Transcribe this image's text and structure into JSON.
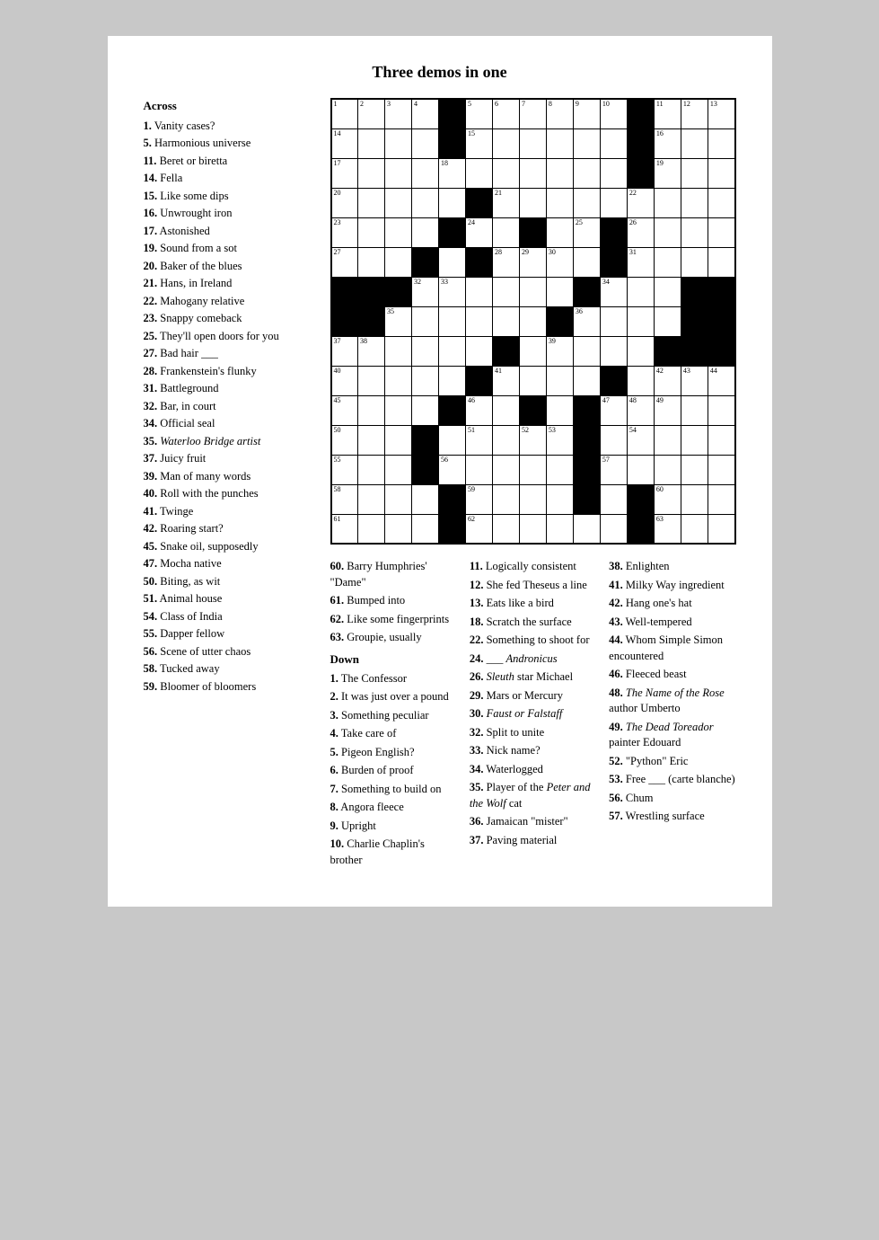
{
  "title": "Three demos in one",
  "across_label": "Across",
  "across_clues": [
    {
      "num": "1",
      "text": "Vanity cases?"
    },
    {
      "num": "5",
      "text": "Harmonious universe"
    },
    {
      "num": "11",
      "text": "Beret or biretta"
    },
    {
      "num": "14",
      "text": "Fella"
    },
    {
      "num": "15",
      "text": "Like some dips"
    },
    {
      "num": "16",
      "text": "Unwrought iron"
    },
    {
      "num": "17",
      "text": "Astonished"
    },
    {
      "num": "19",
      "text": "Sound from a sot"
    },
    {
      "num": "20",
      "text": "Baker of the blues"
    },
    {
      "num": "21",
      "text": "Hans, in Ireland"
    },
    {
      "num": "22",
      "text": "Mahogany relative"
    },
    {
      "num": "23",
      "text": "Snappy comeback"
    },
    {
      "num": "25",
      "text": "They'll open doors for you"
    },
    {
      "num": "27",
      "text": "Bad hair ___"
    },
    {
      "num": "28",
      "text": "Frankenstein's flunky"
    },
    {
      "num": "31",
      "text": "Battleground"
    },
    {
      "num": "32",
      "text": "Bar, in court"
    },
    {
      "num": "34",
      "text": "Official seal"
    },
    {
      "num": "35",
      "text": "Waterloo Bridge artist",
      "italic": true
    },
    {
      "num": "37",
      "text": "Juicy fruit"
    },
    {
      "num": "39",
      "text": "Man of many words"
    },
    {
      "num": "40",
      "text": "Roll with the punches"
    },
    {
      "num": "41",
      "text": "Twinge"
    },
    {
      "num": "42",
      "text": "Roaring start?"
    },
    {
      "num": "45",
      "text": "Snake oil, supposedly"
    },
    {
      "num": "47",
      "text": "Mocha native"
    },
    {
      "num": "50",
      "text": "Biting, as wit"
    },
    {
      "num": "51",
      "text": "Animal house"
    },
    {
      "num": "54",
      "text": "Class of India"
    },
    {
      "num": "55",
      "text": "Dapper fellow"
    },
    {
      "num": "56",
      "text": "Scene of utter chaos"
    },
    {
      "num": "58",
      "text": "Tucked away"
    },
    {
      "num": "59",
      "text": "Bloomer of bloomers"
    }
  ],
  "right_clues_col1": [
    {
      "num": "60",
      "text": "Barry Humphries' \"Dame\""
    },
    {
      "num": "61",
      "text": "Bumped into"
    },
    {
      "num": "62",
      "text": "Like some fingerprints"
    },
    {
      "num": "63",
      "text": "Groupie, usually"
    }
  ],
  "down_label": "Down",
  "down_clues_col1": [
    {
      "num": "1",
      "text": "The Confessor"
    },
    {
      "num": "2",
      "text": "It was just over a pound"
    },
    {
      "num": "3",
      "text": "Something peculiar"
    },
    {
      "num": "4",
      "text": "Take care of"
    },
    {
      "num": "5",
      "text": "Pigeon English?"
    },
    {
      "num": "6",
      "text": "Burden of proof"
    },
    {
      "num": "7",
      "text": "Something to build on"
    },
    {
      "num": "8",
      "text": "Angora fleece"
    },
    {
      "num": "9",
      "text": "Upright"
    },
    {
      "num": "10",
      "text": "Charlie Chaplin's brother"
    }
  ],
  "down_clues_col2": [
    {
      "num": "11",
      "text": "Logically consistent"
    },
    {
      "num": "12",
      "text": "She fed Theseus a line"
    },
    {
      "num": "13",
      "text": "Eats like a bird"
    },
    {
      "num": "18",
      "text": "Scratch the surface"
    },
    {
      "num": "22",
      "text": "Something to shoot for"
    },
    {
      "num": "24",
      "text": "___ Andronicus",
      "italic_part": "Andronicus"
    },
    {
      "num": "26",
      "text": "Sleuth star Michael",
      "italic_part": "Sleuth"
    },
    {
      "num": "29",
      "text": "Mars or Mercury"
    },
    {
      "num": "30",
      "text": "Faust or Falstaff",
      "italic_part": "Faust or Falstaff"
    },
    {
      "num": "32",
      "text": "Split to unite"
    },
    {
      "num": "33",
      "text": "Nick name?"
    },
    {
      "num": "34",
      "text": "Waterlogged"
    },
    {
      "num": "35",
      "text": "Player of the Peter and the Wolf cat",
      "italic_part": "Peter and the Wolf"
    },
    {
      "num": "36",
      "text": "Jamaican \"mister\""
    },
    {
      "num": "37",
      "text": "Paving material"
    }
  ],
  "down_clues_col3": [
    {
      "num": "38",
      "text": "Enlighten"
    },
    {
      "num": "41",
      "text": "Milky Way ingredient"
    },
    {
      "num": "42",
      "text": "Hang one's hat"
    },
    {
      "num": "43",
      "text": "Well-tempered"
    },
    {
      "num": "44",
      "text": "Whom Simple Simon encountered"
    },
    {
      "num": "46",
      "text": "Fleeced beast"
    },
    {
      "num": "48",
      "text": "The Name of the Rose author Umberto",
      "italic_part": "The Name of the Rose"
    },
    {
      "num": "49",
      "text": "The Dead Toreador painter Edouard",
      "italic_part": "The Dead Toreador"
    },
    {
      "num": "52",
      "text": "\"Python\" Eric"
    },
    {
      "num": "53",
      "text": "Free ___ (carte blanche)"
    },
    {
      "num": "56",
      "text": "Chum"
    },
    {
      "num": "57",
      "text": "Wrestling surface"
    }
  ]
}
